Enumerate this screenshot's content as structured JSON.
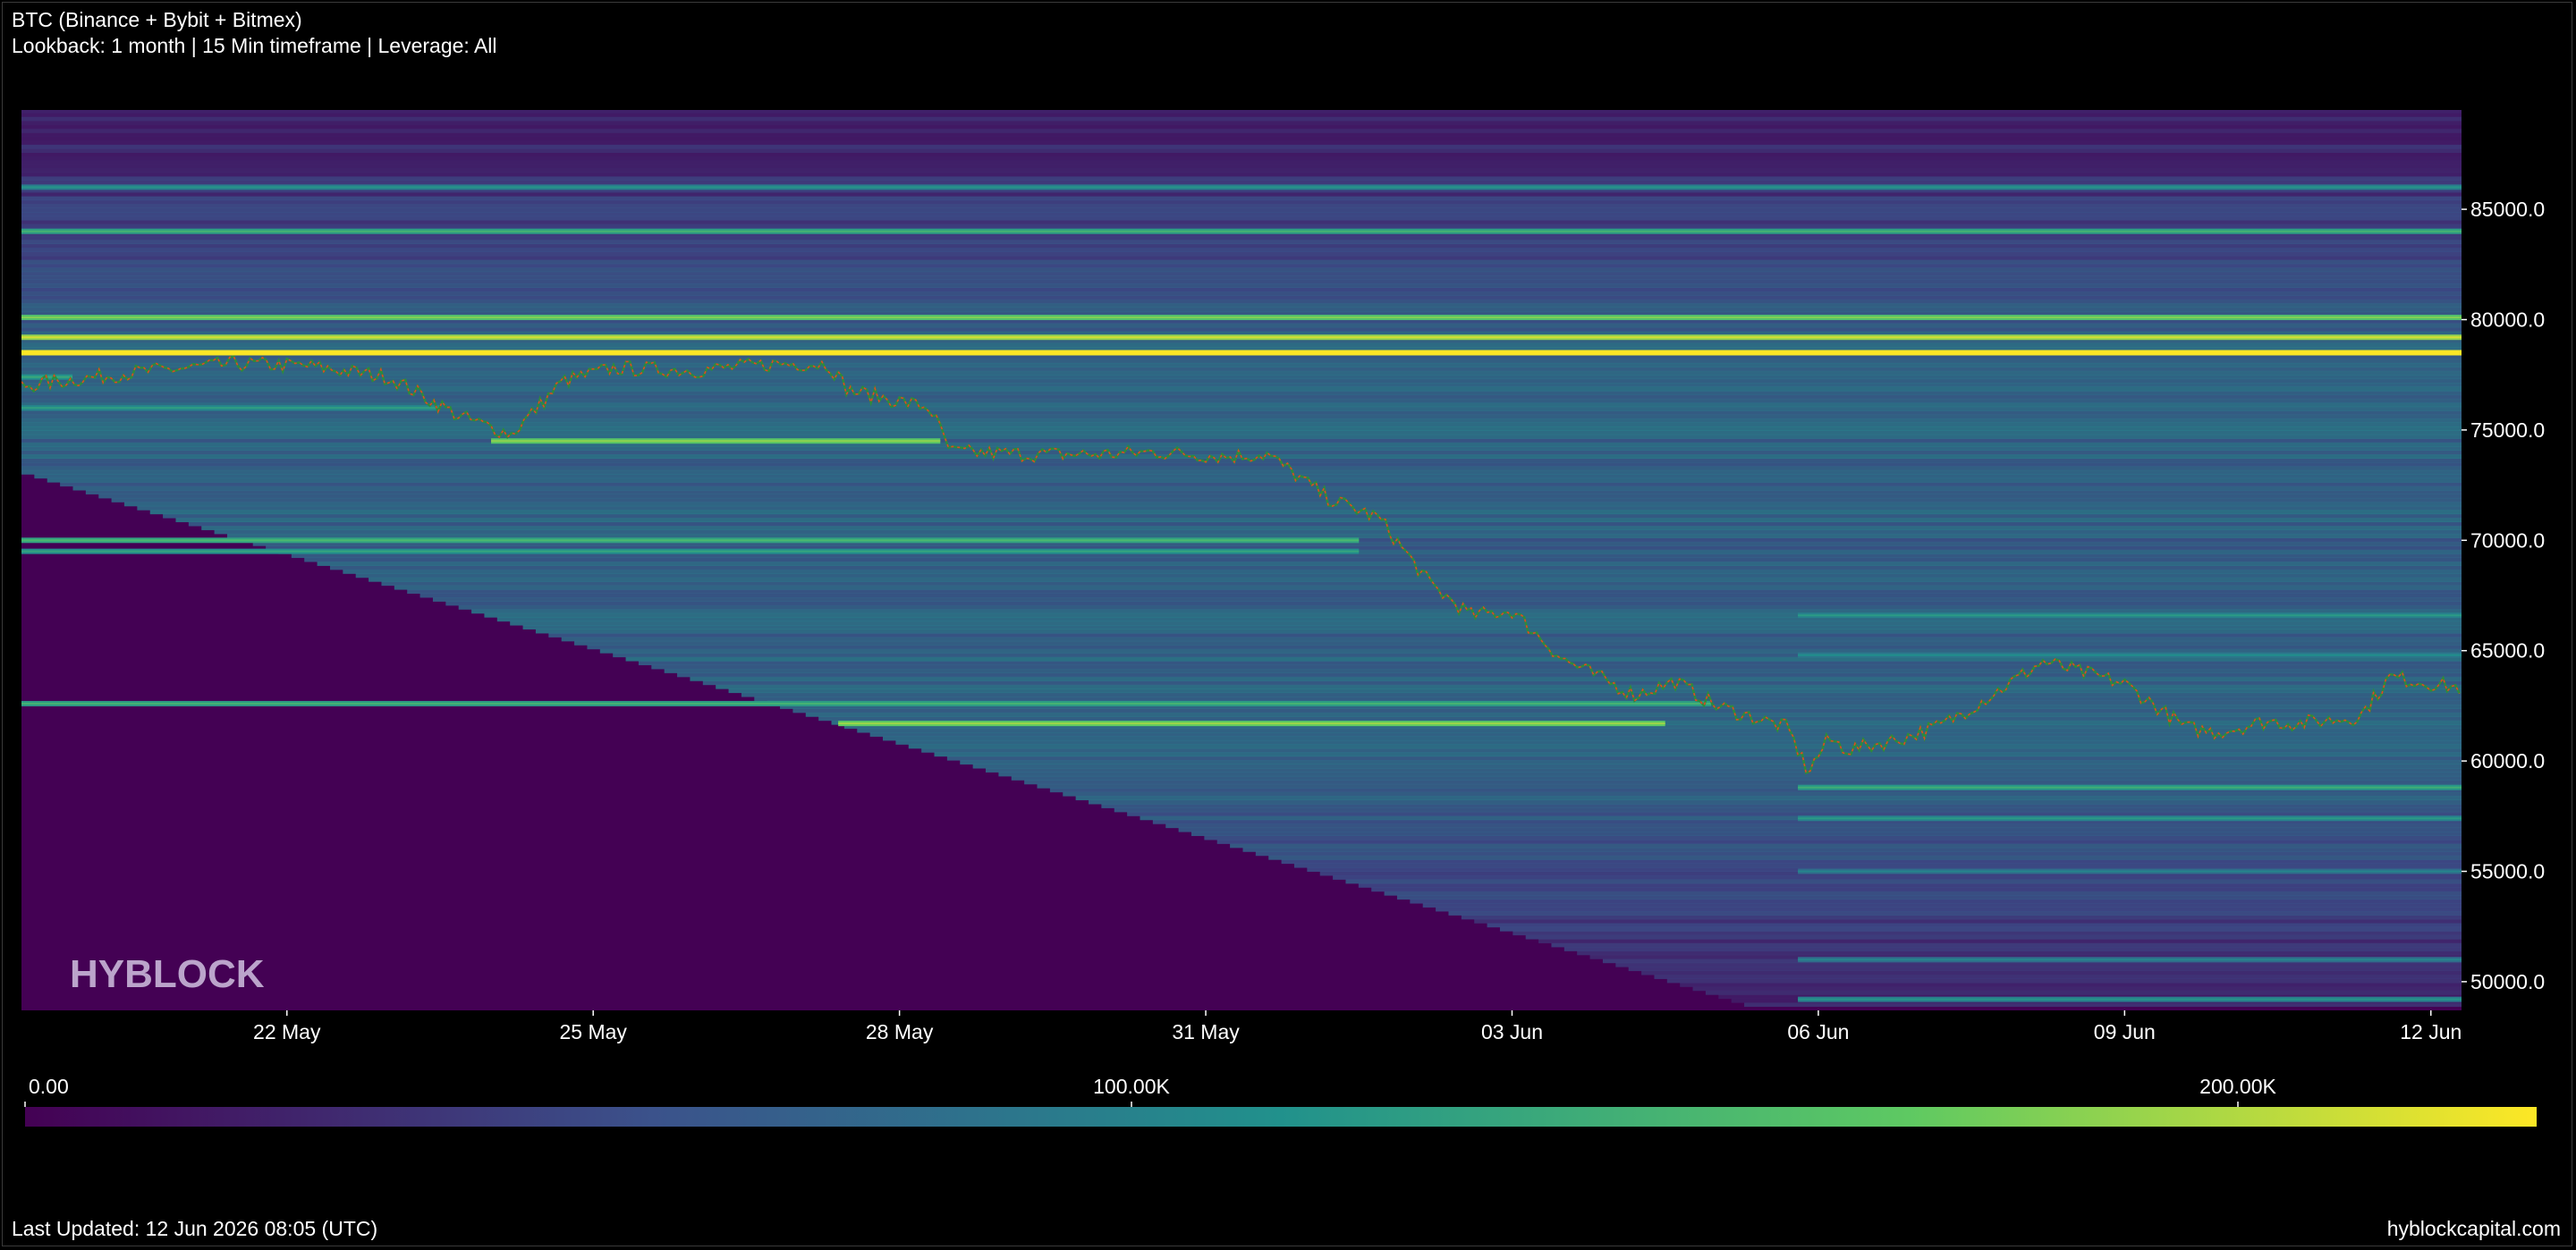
{
  "header": {
    "title": "BTC (Binance + Bybit + Bitmex)",
    "subtitle": "Lookback: 1 month | 15 Min timeframe | Leverage: All"
  },
  "footer": {
    "last_updated": "Last Updated: 12 Jun 2026 08:05 (UTC)",
    "site": "hyblockcapital.com"
  },
  "watermark": "HYBLOCK",
  "chart_data": {
    "type": "heatmap",
    "x_tick_labels": [
      "22 May",
      "25 May",
      "28 May",
      "31 May",
      "03 Jun",
      "06 Jun",
      "09 Jun",
      "12 Jun"
    ],
    "x_ticks_day": [
      3,
      6,
      9,
      12,
      15,
      18,
      21,
      24
    ],
    "x_range_day": [
      0.4,
      24.3
    ],
    "y_tick_labels": [
      "50000.0",
      "55000.0",
      "60000.0",
      "65000.0",
      "70000.0",
      "75000.0",
      "80000.0",
      "85000.0"
    ],
    "y_ticks": [
      50000,
      55000,
      60000,
      65000,
      70000,
      75000,
      80000,
      85000
    ],
    "ylim": [
      48700,
      89500
    ],
    "colorbar": {
      "tick_labels": [
        "0.00",
        "100.00K",
        "200.00K"
      ],
      "ticks": [
        0,
        100000,
        200000
      ],
      "range": [
        0,
        227000
      ],
      "colormap": [
        "#440154",
        "#3b528b",
        "#21918c",
        "#5ec962",
        "#fde725"
      ]
    },
    "price_series": {
      "name": "BTC price",
      "day": [
        0.4,
        1.5,
        2.5,
        3.2,
        4.0,
        4.7,
        5.2,
        5.7,
        6.2,
        7.0,
        7.8,
        8.3,
        8.5,
        9.3,
        9.5,
        10.3,
        11.0,
        11.5,
        12.2,
        12.6,
        13.2,
        13.7,
        14.2,
        14.6,
        15.0,
        15.5,
        16.2,
        16.6,
        17.0,
        17.7,
        17.9,
        18.1,
        18.3,
        18.8,
        19.2,
        19.7,
        20.2,
        21.0,
        21.6,
        21.9,
        22.4,
        22.7,
        23.3,
        23.6,
        24.3
      ],
      "price": [
        77000,
        77600,
        78000,
        77900,
        77400,
        75600,
        74800,
        77200,
        77800,
        77700,
        78000,
        78000,
        76800,
        76000,
        74000,
        73900,
        73900,
        74000,
        73800,
        73900,
        71900,
        71000,
        68000,
        66600,
        66800,
        64600,
        63000,
        63600,
        62500,
        61500,
        59500,
        61000,
        60500,
        61000,
        61600,
        63000,
        64500,
        63500,
        61500,
        61300,
        61800,
        61700,
        62000,
        63800,
        63300
      ]
    },
    "liquidation_levels": [
      {
        "price": 80100,
        "value": 160000
      },
      {
        "price": 79200,
        "value": 190000
      },
      {
        "price": 78500,
        "value": 225000
      },
      {
        "price": 77400,
        "value": 115000
      },
      {
        "price": 76000,
        "value": 105000
      },
      {
        "price": 84000,
        "value": 125000
      },
      {
        "price": 86000,
        "value": 95000
      },
      {
        "price": 74500,
        "value": 165000
      },
      {
        "price": 70000,
        "value": 130000
      },
      {
        "price": 69500,
        "value": 110000
      },
      {
        "price": 66600,
        "value": 100000
      },
      {
        "price": 64800,
        "value": 90000
      },
      {
        "price": 62600,
        "value": 125000
      },
      {
        "price": 61700,
        "value": 170000
      },
      {
        "price": 58800,
        "value": 120000
      },
      {
        "price": 57400,
        "value": 100000
      },
      {
        "price": 55000,
        "value": 80000
      },
      {
        "price": 51000,
        "value": 80000
      },
      {
        "price": 49200,
        "value": 95000
      }
    ]
  }
}
